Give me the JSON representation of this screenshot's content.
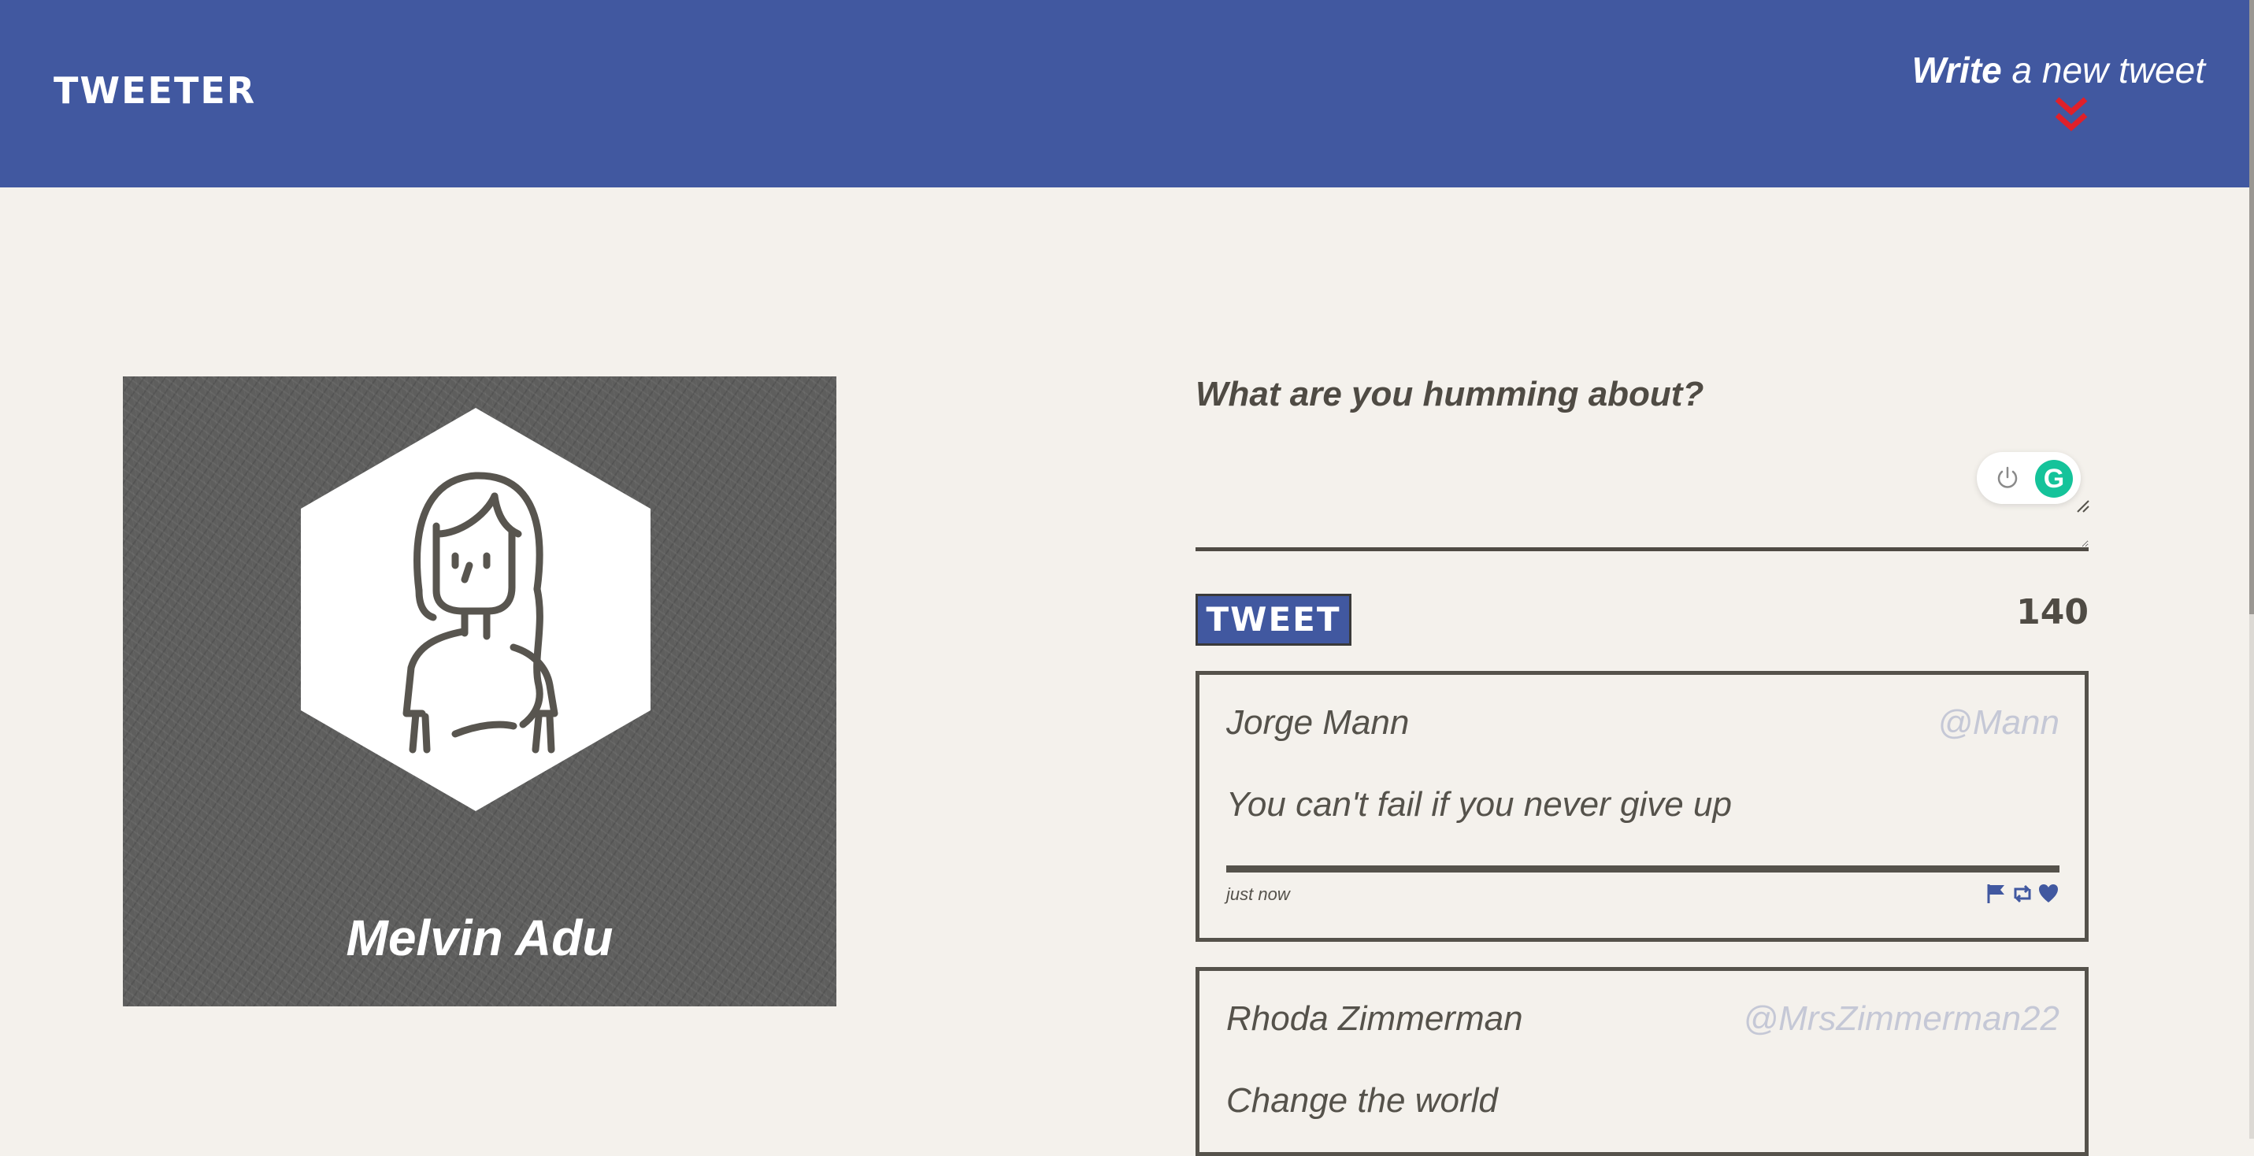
{
  "nav": {
    "brand": "TWEETER",
    "compose_strong": "Write",
    "compose_rest": " a new tweet",
    "chevron_icon": "double-chevron-down-icon",
    "chevron_color": "#e0202a"
  },
  "colors": {
    "nav_bg": "#4158a0",
    "page_bg": "#f4f1ec",
    "ink": "#4f4b44",
    "handle": "#c5c8d6",
    "grammarly": "#15c39a"
  },
  "profile": {
    "name": "Melvin Adu",
    "avatar_icon": "person-avatar-icon"
  },
  "compose": {
    "prompt": "What are you humming about?",
    "value": "",
    "button_label": "TWEET",
    "counter": "140",
    "grammarly_letter": "G"
  },
  "tweets": [
    {
      "name": "Jorge Mann",
      "handle": "@Mann",
      "body": "You can't fail if you never give up",
      "time": "just now",
      "actions": [
        "flag-icon",
        "retweet-icon",
        "heart-icon"
      ]
    },
    {
      "name": "Rhoda Zimmerman",
      "handle": "@MrsZimmerman22",
      "body": "Change the world"
    }
  ]
}
